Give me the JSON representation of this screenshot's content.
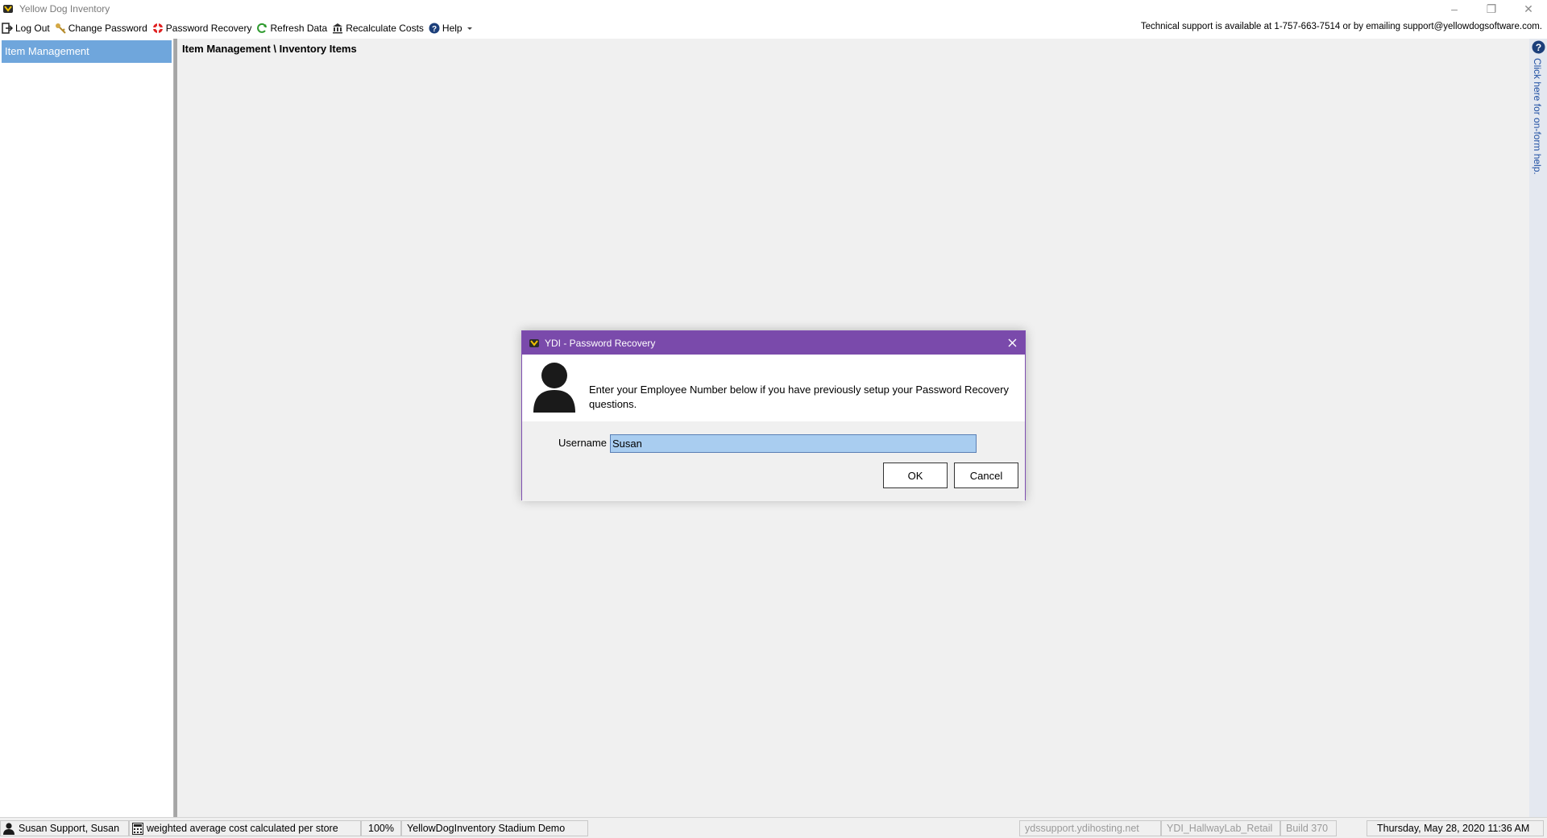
{
  "window": {
    "title": "Yellow Dog Inventory",
    "minimize": "–",
    "restore": "❐",
    "close": "✕"
  },
  "toolbar": {
    "items": [
      {
        "label": "Log Out",
        "icon": "logout-icon"
      },
      {
        "label": "Change Password",
        "icon": "key-icon"
      },
      {
        "label": "Password Recovery",
        "icon": "lifebuoy-icon"
      },
      {
        "label": "Refresh Data",
        "icon": "refresh-icon"
      },
      {
        "label": "Recalculate Costs",
        "icon": "bank-icon"
      },
      {
        "label": "Help",
        "icon": "help-icon"
      }
    ],
    "support_text": "Technical support is available at 1-757-663-7514 or by emailing support@yellowdogsoftware.com."
  },
  "sidebar": {
    "items": [
      {
        "label": "Item Management",
        "selected": true
      }
    ]
  },
  "main": {
    "breadcrumb": "Item Management \\ Inventory Items"
  },
  "help_strip": {
    "text": "Click here for on-form help."
  },
  "dialog": {
    "title": "YDI - Password Recovery",
    "message": "Enter your Employee Number below if you have previously setup your Password Recovery questions.",
    "username_label": "Username",
    "username_value": "Susan",
    "ok_label": "OK",
    "cancel_label": "Cancel"
  },
  "statusbar": {
    "user": "Susan Support, Susan",
    "cost_method": "weighted average cost calculated per store",
    "zoom": "100%",
    "database": "YellowDogInventory Stadium Demo",
    "server": "ydssupport.ydihosting.net",
    "location": "YDI_HallwayLab_Retail",
    "build": "Build 370",
    "datetime": "Thursday, May 28, 2020 11:36 AM"
  },
  "colors": {
    "dialog_title_bg": "#7a4aab",
    "sidebar_selected": "#6fa6dc",
    "input_selection": "#a9cdf0",
    "help_link": "#1f4fa3"
  }
}
